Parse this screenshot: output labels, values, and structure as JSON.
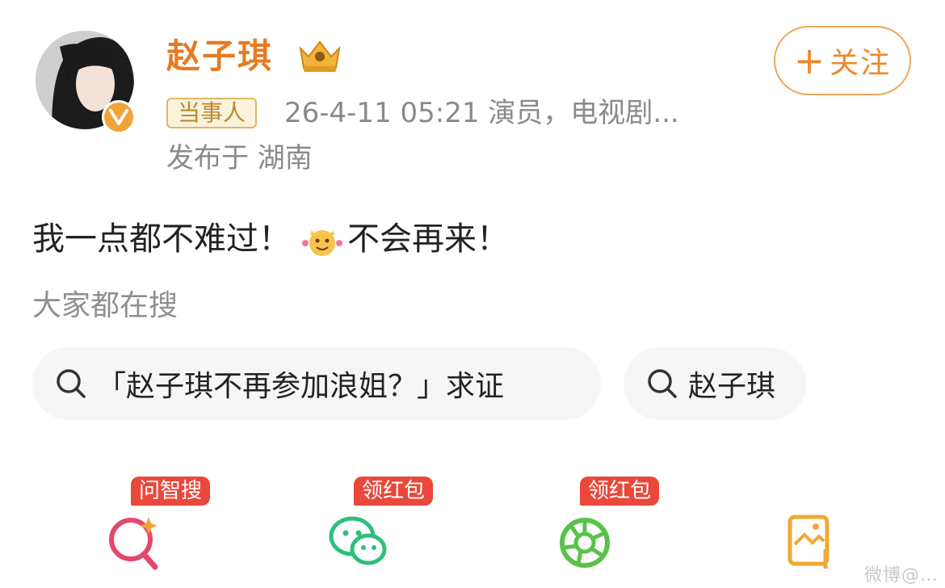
{
  "user": {
    "name": "赵子琪",
    "tag": "当事人",
    "meta": "26-4-11 05:21  演员，电视剧...",
    "location": "发布于 湖南"
  },
  "follow": {
    "plus": "+",
    "label": "关注"
  },
  "post": {
    "text_before": "我一点都不难过！",
    "text_after": "不会再来！"
  },
  "search": {
    "title": "大家都在搜",
    "chips": [
      "「赵子琪不再参加浪姐？」求证",
      "赵子琪"
    ]
  },
  "bottom_bar": [
    {
      "badge": "问智搜",
      "icon": "ai-search-icon"
    },
    {
      "badge": "领红包",
      "icon": "wechat-icon"
    },
    {
      "badge": "领红包",
      "icon": "moments-icon"
    },
    {
      "badge": "",
      "icon": "save-image-icon"
    }
  ],
  "watermark": "微博@…"
}
